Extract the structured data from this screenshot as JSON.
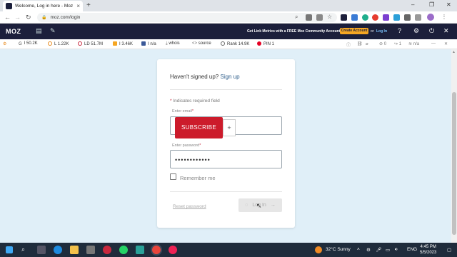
{
  "browser": {
    "tab_title": "Welcome, Log in here - Moz",
    "url": "moz.com/login",
    "new_tab": "+",
    "tab_close": "×",
    "window_min": "–",
    "window_max": "❐",
    "window_close": "✕",
    "nav_back": "←",
    "nav_forward": "→",
    "nav_reload": "↻"
  },
  "mozbar": {
    "logo": "MOZ",
    "promo_text": "Get Link Metrics with a FREE Moz Community Account",
    "create_account": "Create Account",
    "or_text": "or",
    "login_link": "Log In",
    "help": "?"
  },
  "metrics": {
    "pa": "I 50.2K",
    "links": "L 1.22K",
    "ld": "LD 51.7M",
    "fb": "I 3.46K",
    "fb_na": "I n/a",
    "whois": "whois",
    "source": "source",
    "rank": "Rank 14.9K",
    "pin": "PIN 1",
    "r_count0": "0",
    "r_count1": "1",
    "r_na": "n/a"
  },
  "form": {
    "signup_prompt": "Haven't signed up?",
    "signup_link": "Sign up",
    "required_note": "Indicates required field",
    "required_star": "*",
    "email_label": "Enter email",
    "password_label": "Enter password",
    "password_value": "••••••••••••",
    "remember_me": "Remember me",
    "reset_password": "Reset password",
    "login_button": "Log In",
    "login_arrow": "→"
  },
  "overlay": {
    "subscribe": "SUBSCRIBE",
    "plus": "+"
  },
  "taskbar": {
    "weather": "32°C  Sunny",
    "language": "ENG",
    "time": "4:45 PM",
    "date": "5/5/2023"
  },
  "colors": {
    "moz_navy": "#1c1f3b",
    "create_orange": "#f5a623",
    "subscribe_red": "#cc1b2b",
    "page_bg": "#e0eff8"
  }
}
